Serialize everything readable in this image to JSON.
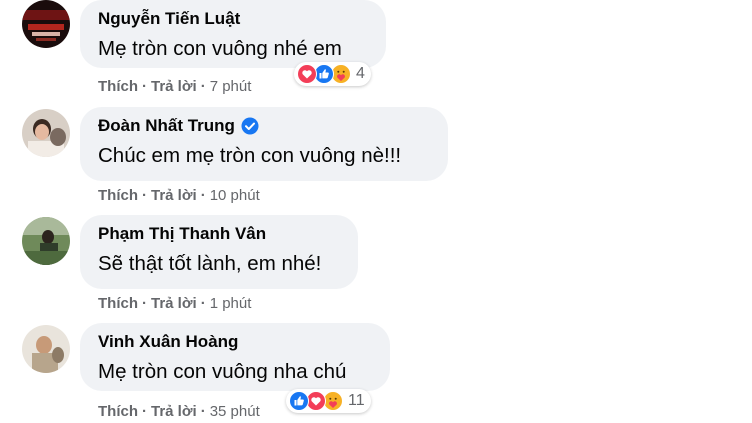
{
  "comments": [
    {
      "name": "Nguyễn Tiến Luật",
      "text": "Mẹ tròn con vuông nhé em",
      "like_label": "Thích",
      "reply_label": "Trả lời",
      "time": "7 phút",
      "verified": false,
      "reactions": [
        "love-icon",
        "like-icon",
        "care-icon"
      ],
      "reaction_count": "4"
    },
    {
      "name": "Đoàn Nhất Trung",
      "text": "Chúc em mẹ tròn con vuông nè!!!",
      "like_label": "Thích",
      "reply_label": "Trả lời",
      "time": "10 phút",
      "verified": true
    },
    {
      "name": "Phạm Thị Thanh Vân",
      "text": "Sẽ thật tốt lành, em nhé!",
      "like_label": "Thích",
      "reply_label": "Trả lời",
      "time": "1 phút",
      "verified": false
    },
    {
      "name": "Vinh Xuân Hoàng",
      "text": "Mẹ tròn con vuông nha chú",
      "like_label": "Thích",
      "reply_label": "Trả lời",
      "time": "35 phút",
      "verified": false,
      "reactions": [
        "like-icon",
        "love-icon",
        "care-icon"
      ],
      "reaction_count": "11"
    }
  ],
  "colors": {
    "bubble": "#f0f2f5",
    "secondary_text": "#65676b",
    "like_blue": "#1877f2",
    "love_red": "#f33e58",
    "care_yellow": "#f7b125"
  }
}
